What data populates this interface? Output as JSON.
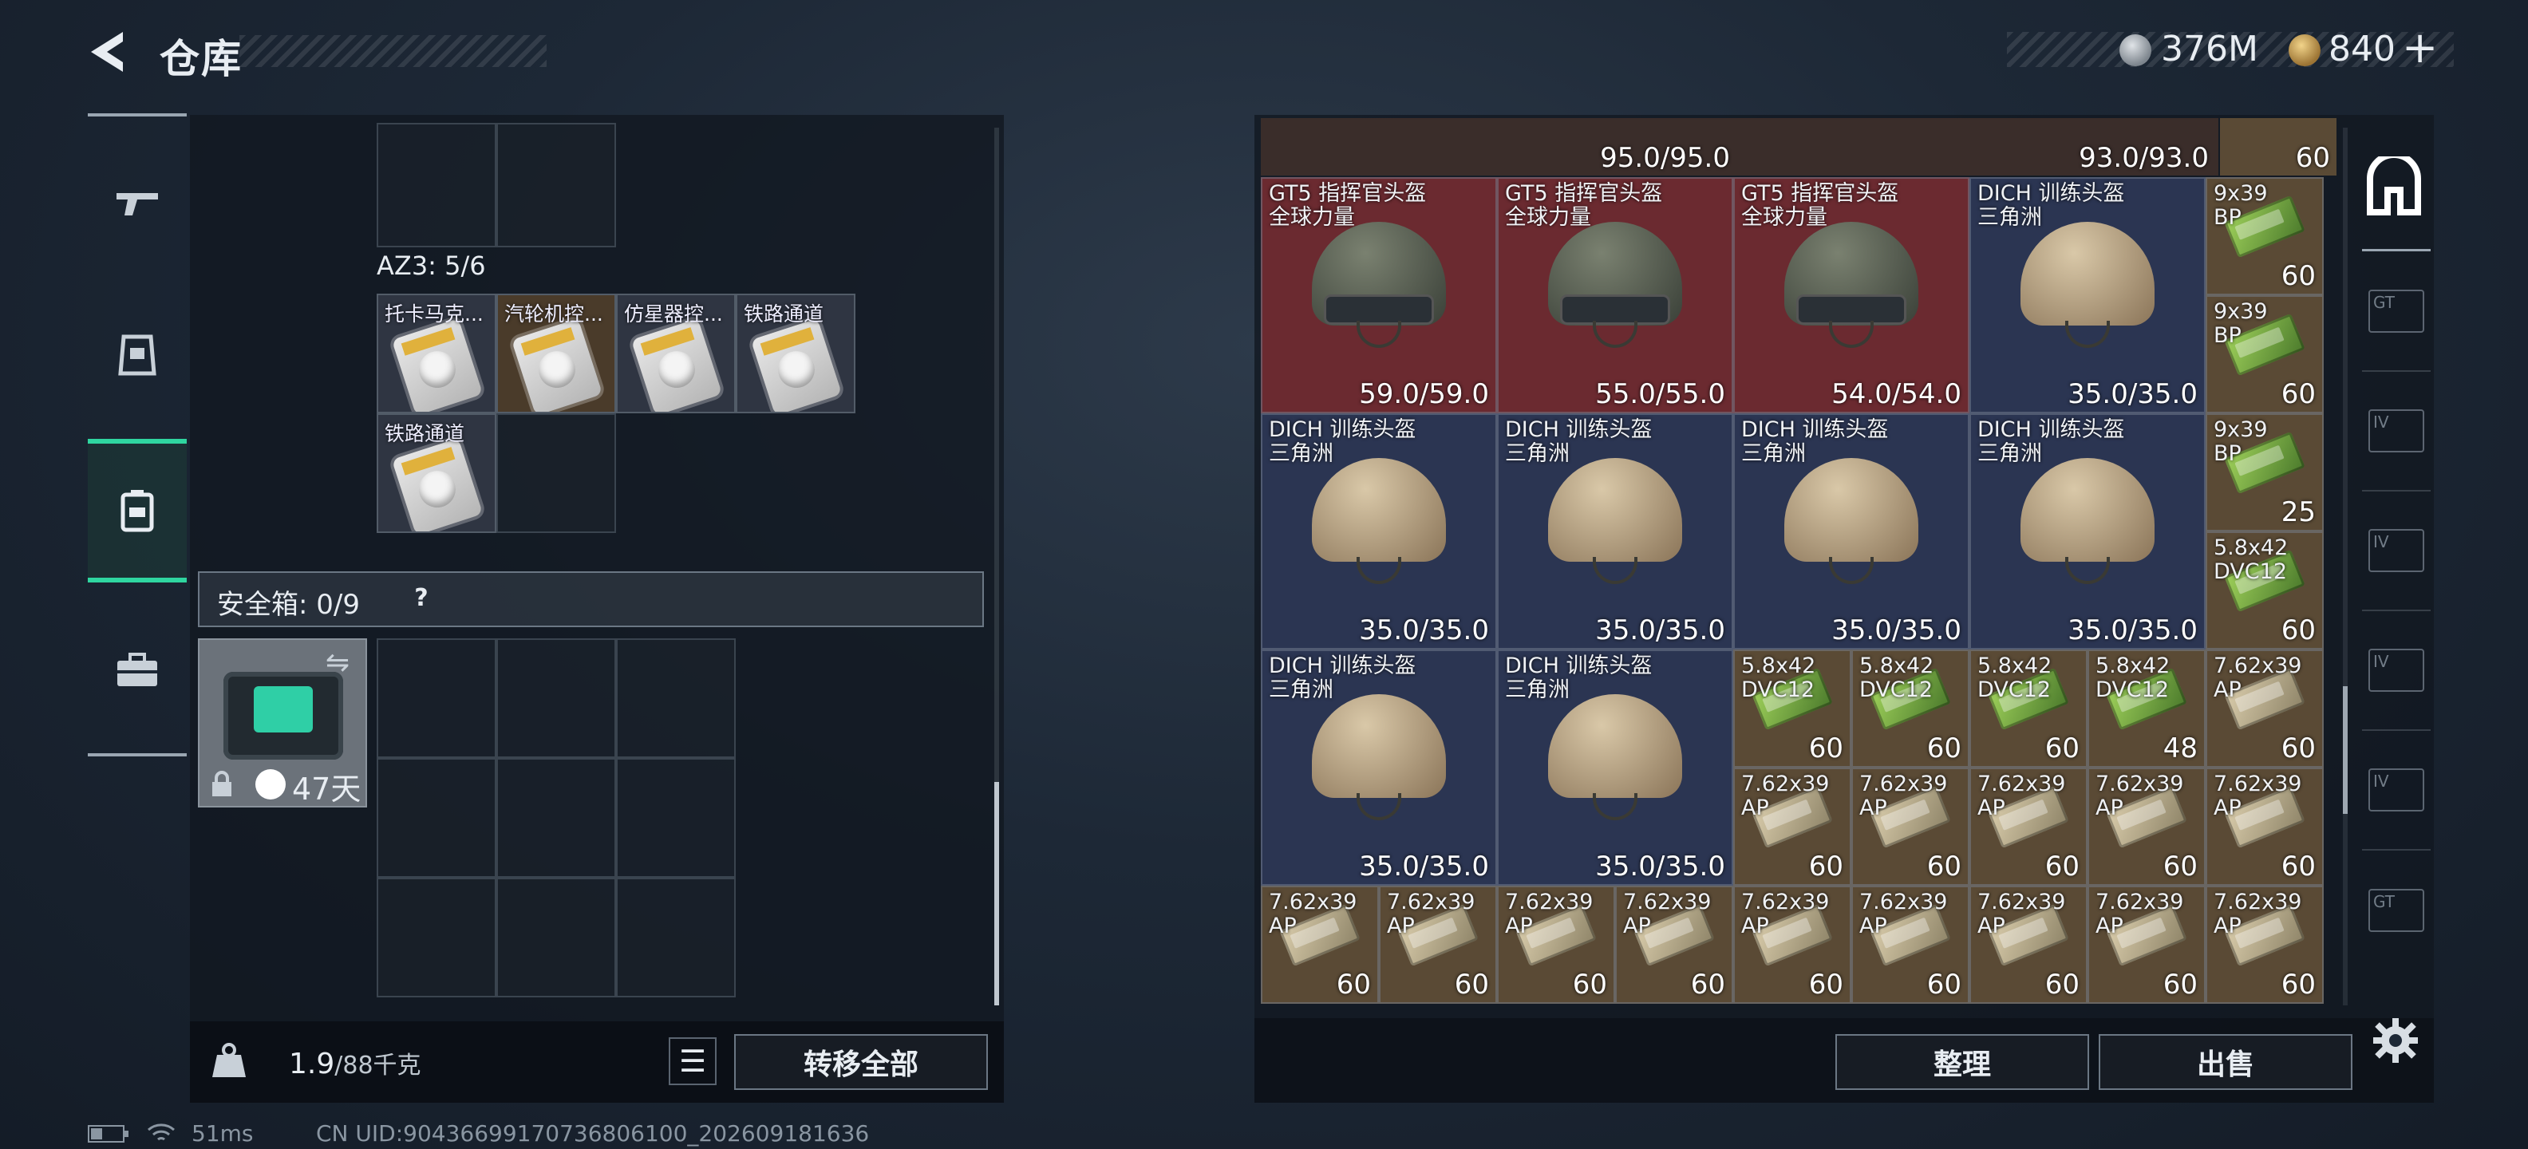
{
  "header": {
    "title": "仓库",
    "currency_silver": "376M",
    "currency_gold": "840",
    "plus_label": "+"
  },
  "left_panel": {
    "container_title": "AZ3: 5/6",
    "items": [
      {
        "label": "托卡马克..."
      },
      {
        "label": "汽轮机控..."
      },
      {
        "label": "仿星器控..."
      },
      {
        "label": "铁路通道"
      },
      {
        "label": "铁路通道"
      }
    ],
    "safe_box": {
      "label": "安全箱: 0/9",
      "help": "?",
      "days": "47天"
    },
    "weight": {
      "current": "1.9",
      "max": "/88千克"
    },
    "transfer_all": "转移全部"
  },
  "right_panel": {
    "top_values": [
      "95.0/95.0",
      "93.0/93.0",
      "60"
    ],
    "helmets": [
      {
        "name": "GT5 指挥官头盔\n全球力量",
        "value": "59.0/59.0",
        "color": "#6b2a30"
      },
      {
        "name": "GT5 指挥官头盔\n全球力量",
        "value": "55.0/55.0",
        "color": "#6b2a30"
      },
      {
        "name": "GT5 指挥官头盔\n全球力量",
        "value": "54.0/54.0",
        "color": "#6b2a30"
      },
      {
        "name": "DICH 训练头盔\n三角洲",
        "value": "35.0/35.0",
        "color": "#2b3552"
      },
      {
        "name": "DICH 训练头盔\n三角洲",
        "value": "35.0/35.0",
        "color": "#2b3552"
      },
      {
        "name": "DICH 训练头盔\n三角洲",
        "value": "35.0/35.0",
        "color": "#2b3552"
      },
      {
        "name": "DICH 训练头盔\n三角洲",
        "value": "35.0/35.0",
        "color": "#2b3552"
      },
      {
        "name": "DICH 训练头盔\n三角洲",
        "value": "35.0/35.0",
        "color": "#2b3552"
      },
      {
        "name": "DICH 训练头盔\n三角洲",
        "value": "35.0/35.0",
        "color": "#2b3552"
      },
      {
        "name": "DICH 训练头盔\n三角洲",
        "value": "35.0/35.0",
        "color": "#2b3552"
      }
    ],
    "ammo_col": [
      {
        "name": "9x39\nBP",
        "value": "60"
      },
      {
        "name": "9x39\nBP",
        "value": "60"
      },
      {
        "name": "9x39\nBP",
        "value": "25"
      },
      {
        "name": "5.8x42\nDVC12",
        "value": "60"
      }
    ],
    "ammo_row1": [
      {
        "name": "5.8x42\nDVC12",
        "value": "60"
      },
      {
        "name": "5.8x42\nDVC12",
        "value": "60"
      },
      {
        "name": "5.8x42\nDVC12",
        "value": "60"
      },
      {
        "name": "5.8x42\nDVC12",
        "value": "48"
      },
      {
        "name": "7.62x39\nAP",
        "value": "60"
      }
    ],
    "ammo_row2": [
      {
        "name": "7.62x39\nAP",
        "value": "60"
      },
      {
        "name": "7.62x39\nAP",
        "value": "60"
      },
      {
        "name": "7.62x39\nAP",
        "value": "60"
      },
      {
        "name": "7.62x39\nAP",
        "value": "60"
      },
      {
        "name": "7.62x39\nAP",
        "value": "60"
      }
    ],
    "ammo_row3": [
      {
        "name": "7.62x39\nAP",
        "value": "60"
      },
      {
        "name": "7.62x39\nAP",
        "value": "60"
      },
      {
        "name": "7.62x39\nAP",
        "value": "60"
      },
      {
        "name": "7.62x39\nAP",
        "value": "60"
      },
      {
        "name": "7.62x39\nAP",
        "value": "60"
      },
      {
        "name": "7.62x39\nAP",
        "value": "60"
      },
      {
        "name": "7.62x39\nAP",
        "value": "60"
      },
      {
        "name": "7.62x39\nAP",
        "value": "60"
      },
      {
        "name": "7.62x39\nAP",
        "value": "60"
      }
    ],
    "organize": "整理",
    "sell": "出售"
  },
  "right_sidebar": {
    "cards": [
      "GT",
      "IV",
      "IV",
      "IV",
      "IV",
      "GT"
    ]
  },
  "status_bar": {
    "ping": "51ms",
    "uid": "CN UID:9043669917073680610​0_202609181636"
  },
  "colors": {
    "accent": "#2fd6a0",
    "helmet_red": "#6b2a30",
    "helmet_blue": "#2b3552",
    "ammo_olive": "#5a4a35"
  }
}
